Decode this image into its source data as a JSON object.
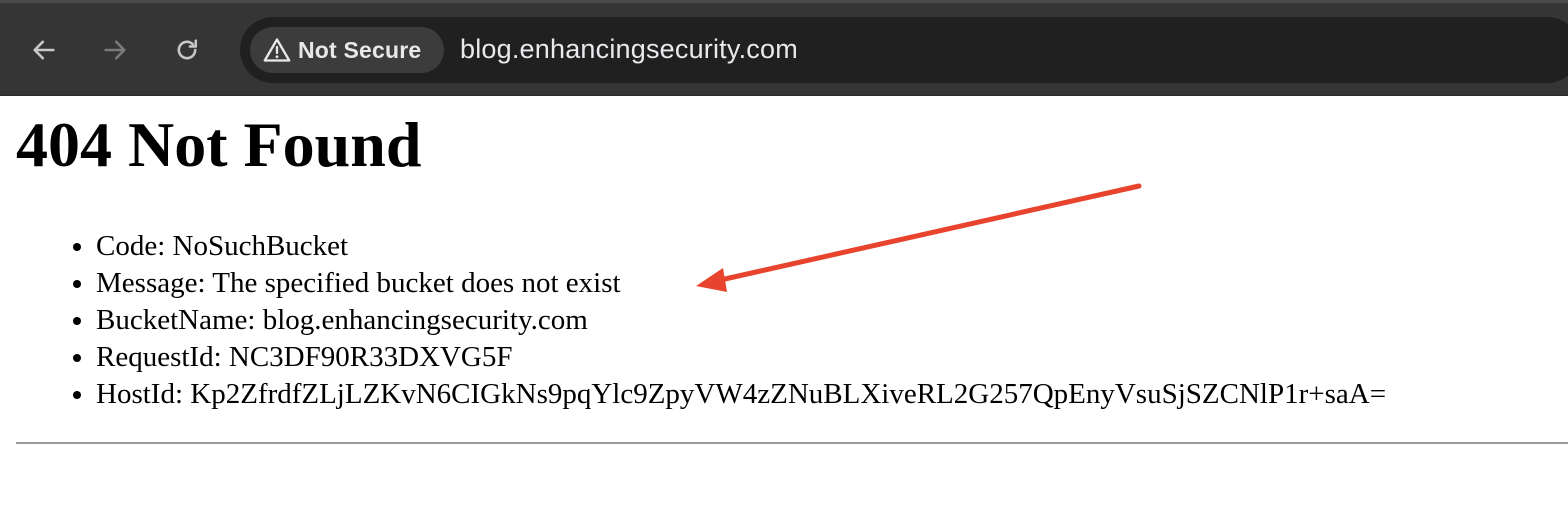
{
  "browser": {
    "security_label": "Not Secure",
    "url": "blog.enhancingsecurity.com",
    "icons": {
      "back": "back-arrow-icon",
      "forward": "forward-arrow-icon",
      "reload": "reload-icon",
      "security": "warning-triangle-icon"
    }
  },
  "page": {
    "title": "404 Not Found",
    "details": [
      {
        "key": "Code",
        "value": "NoSuchBucket",
        "text": "Code: NoSuchBucket"
      },
      {
        "key": "Message",
        "value": "The specified bucket does not exist",
        "text": "Message: The specified bucket does not exist"
      },
      {
        "key": "BucketName",
        "value": "blog.enhancingsecurity.com",
        "text": "BucketName: blog.enhancingsecurity.com"
      },
      {
        "key": "RequestId",
        "value": "NC3DF90R33DXVG5F",
        "text": "RequestId: NC3DF90R33DXVG5F"
      },
      {
        "key": "HostId",
        "value": "Kp2ZfrdfZLjLZKvN6CIGkNs9pqYlc9ZpyVW4zZNuBLXiveRL2G257QpEnyVsuSjSZCNlP1r+saA=",
        "text": "HostId: Kp2ZfrdfZLjLZKvN6CIGkNs9pqYlc9ZpyVW4zZNuBLXiveRL2G257QpEnyVsuSjSZCNlP1r+saA="
      }
    ]
  },
  "colors": {
    "toolbar_bg": "#353535",
    "omnibox_bg": "#202020",
    "chip_bg": "#3c3c3c",
    "annotation_arrow": "#e8432d"
  }
}
